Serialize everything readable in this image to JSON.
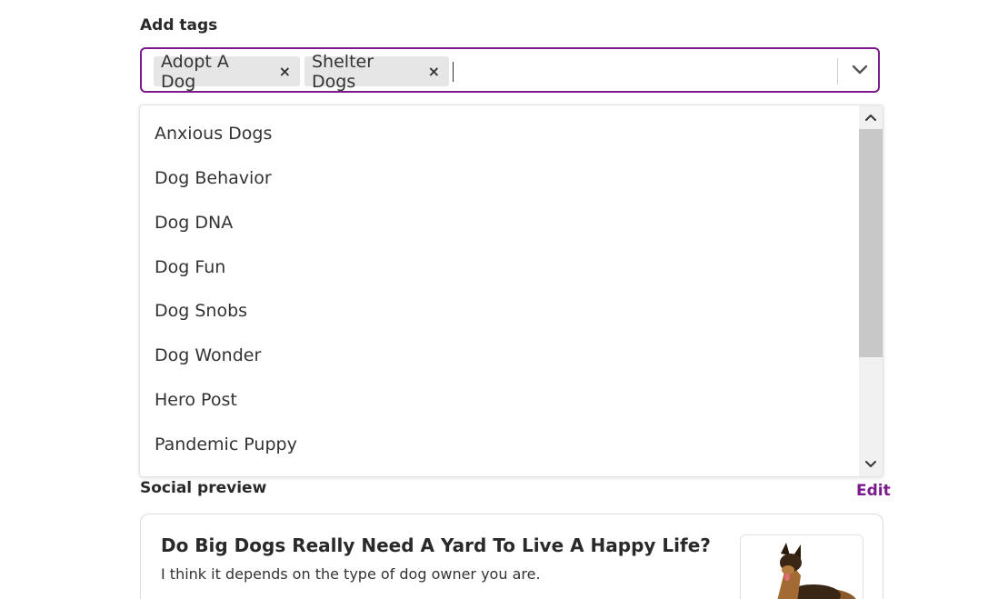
{
  "tags": {
    "label": "Add tags",
    "selected": [
      {
        "label": "Adopt A Dog",
        "remove": "×"
      },
      {
        "label": "Shelter Dogs",
        "remove": "×"
      }
    ],
    "accent_color": "#7a1a8c"
  },
  "menu": {
    "options": [
      "Anxious Dogs",
      "Dog Behavior",
      "Dog DNA",
      "Dog Fun",
      "Dog Snobs",
      "Dog Wonder",
      "Hero Post",
      "Pandemic Puppy"
    ]
  },
  "social": {
    "label": "Social preview",
    "edit": "Edit",
    "card": {
      "title": "Do Big Dogs Really Need A Yard To Live A Happy Life?",
      "description": "I think it depends on the type of dog owner you are."
    }
  }
}
